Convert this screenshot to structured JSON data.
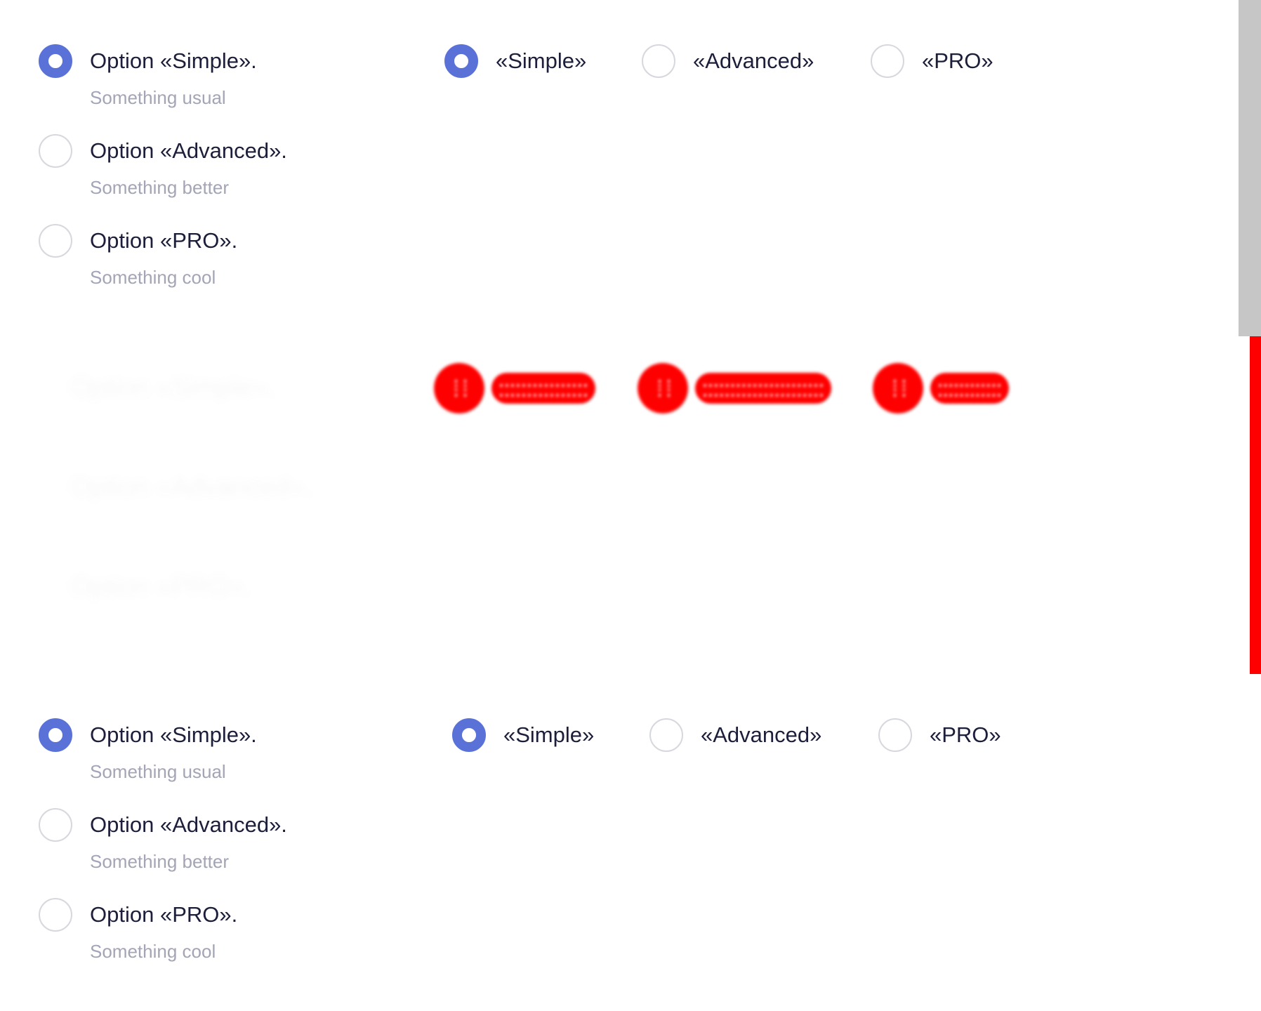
{
  "top_panel": {
    "vertical_options": [
      {
        "title": "Option «Simple».",
        "subtitle": "Something usual",
        "selected": true
      },
      {
        "title": "Option «Advanced».",
        "subtitle": "Something better",
        "selected": false
      },
      {
        "title": "Option «PRO».",
        "subtitle": "Something cool",
        "selected": false
      }
    ],
    "horizontal_options": [
      {
        "label": "«Simple»",
        "selected": true
      },
      {
        "label": "«Advanced»",
        "selected": false
      },
      {
        "label": "«PRO»",
        "selected": false
      }
    ]
  },
  "bottom_panel": {
    "vertical_options": [
      {
        "title": "Option «Simple».",
        "subtitle": "Something usual",
        "selected": true
      },
      {
        "title": "Option «Advanced».",
        "subtitle": "Something better",
        "selected": false
      },
      {
        "title": "Option «PRO».",
        "subtitle": "Something cool",
        "selected": false
      }
    ],
    "horizontal_options": [
      {
        "label": "«Simple»",
        "selected": true
      },
      {
        "label": "«Advanced»",
        "selected": false
      },
      {
        "label": "«PRO»",
        "selected": false
      }
    ]
  },
  "colors": {
    "accent": "#5a72d8",
    "text_primary": "#1c1e3a",
    "text_secondary": "#a3a5b6",
    "radio_border": "#d7d8de",
    "scrollbar": "#c6c6c6",
    "glitch": "#ff0000"
  }
}
